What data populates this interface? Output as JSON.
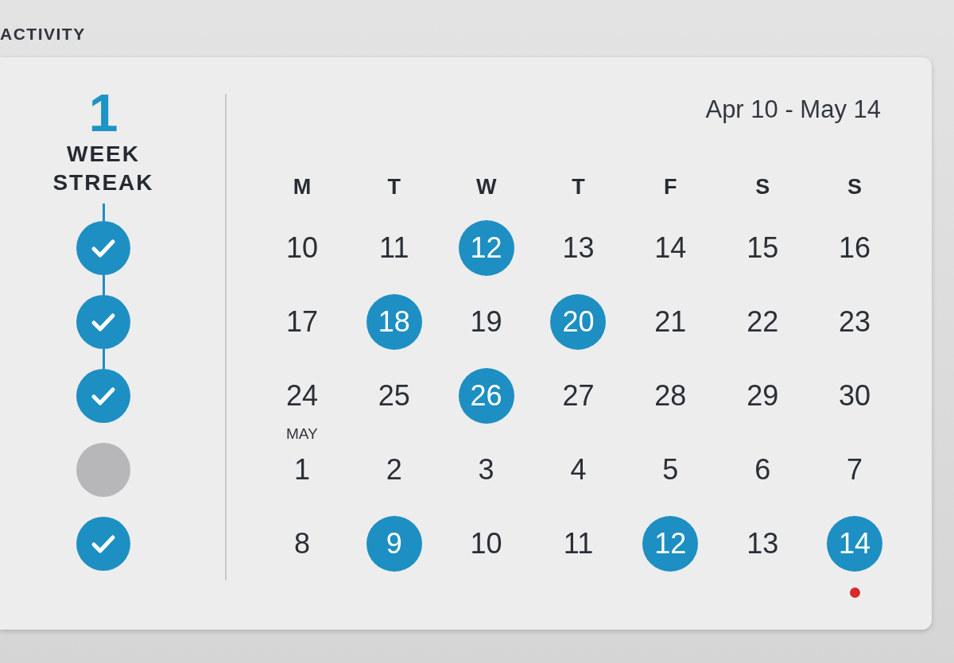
{
  "header": {
    "title": "ACTIVITY"
  },
  "streak": {
    "count": "1",
    "label": "WEEK STREAK",
    "weeks": [
      {
        "completed": true
      },
      {
        "completed": true
      },
      {
        "completed": true
      },
      {
        "completed": false
      },
      {
        "completed": true
      }
    ]
  },
  "calendar": {
    "range": "Apr 10 - May 14",
    "weekdays": [
      "M",
      "T",
      "W",
      "T",
      "F",
      "S",
      "S"
    ],
    "weeks": [
      {
        "days": [
          {
            "day": "10",
            "completed": false,
            "today": false
          },
          {
            "day": "11",
            "completed": false,
            "today": false
          },
          {
            "day": "12",
            "completed": true,
            "today": false
          },
          {
            "day": "13",
            "completed": false,
            "today": false
          },
          {
            "day": "14",
            "completed": false,
            "today": false
          },
          {
            "day": "15",
            "completed": false,
            "today": false
          },
          {
            "day": "16",
            "completed": false,
            "today": false
          }
        ]
      },
      {
        "days": [
          {
            "day": "17",
            "completed": false,
            "today": false
          },
          {
            "day": "18",
            "completed": true,
            "today": false
          },
          {
            "day": "19",
            "completed": false,
            "today": false
          },
          {
            "day": "20",
            "completed": true,
            "today": false
          },
          {
            "day": "21",
            "completed": false,
            "today": false
          },
          {
            "day": "22",
            "completed": false,
            "today": false
          },
          {
            "day": "23",
            "completed": false,
            "today": false
          }
        ]
      },
      {
        "days": [
          {
            "day": "24",
            "completed": false,
            "today": false
          },
          {
            "day": "25",
            "completed": false,
            "today": false
          },
          {
            "day": "26",
            "completed": true,
            "today": false
          },
          {
            "day": "27",
            "completed": false,
            "today": false
          },
          {
            "day": "28",
            "completed": false,
            "today": false
          },
          {
            "day": "29",
            "completed": false,
            "today": false
          },
          {
            "day": "30",
            "completed": false,
            "today": false
          }
        ]
      },
      {
        "days": [
          {
            "day": "1",
            "month_label": "MAY",
            "completed": false,
            "today": false
          },
          {
            "day": "2",
            "completed": false,
            "today": false
          },
          {
            "day": "3",
            "completed": false,
            "today": false
          },
          {
            "day": "4",
            "completed": false,
            "today": false
          },
          {
            "day": "5",
            "completed": false,
            "today": false
          },
          {
            "day": "6",
            "completed": false,
            "today": false
          },
          {
            "day": "7",
            "completed": false,
            "today": false
          }
        ]
      },
      {
        "days": [
          {
            "day": "8",
            "completed": false,
            "today": false
          },
          {
            "day": "9",
            "completed": true,
            "today": false
          },
          {
            "day": "10",
            "completed": false,
            "today": false
          },
          {
            "day": "11",
            "completed": false,
            "today": false
          },
          {
            "day": "12",
            "completed": true,
            "today": false
          },
          {
            "day": "13",
            "completed": false,
            "today": false
          },
          {
            "day": "14",
            "completed": true,
            "today": true
          }
        ]
      }
    ]
  }
}
